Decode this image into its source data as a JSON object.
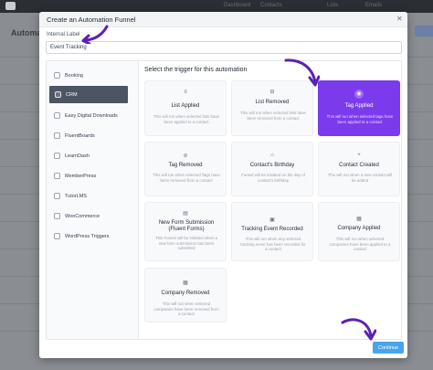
{
  "background": {
    "title": "Automat",
    "nav": [
      "Dashboard",
      "Contacts",
      "Lists",
      "Emails"
    ]
  },
  "modal": {
    "title": "Create an Automation Funnel",
    "internal_label": "Internal Label",
    "internal_value": "Event Tracking",
    "section_title": "Select the trigger for this automation",
    "continue_label": "Continue"
  },
  "sidebar": {
    "items": [
      {
        "label": "Booking"
      },
      {
        "label": "CRM"
      },
      {
        "label": "Easy Digital Downloads"
      },
      {
        "label": "FluentBoards"
      },
      {
        "label": "LearnDash"
      },
      {
        "label": "MemberPress"
      },
      {
        "label": "TutorLMS"
      },
      {
        "label": "WooCommerce"
      },
      {
        "label": "WordPress Triggers"
      }
    ]
  },
  "triggers": [
    {
      "title": "List Applied",
      "desc": "This will run when selected lists have been applied to a contact"
    },
    {
      "title": "List Removed",
      "desc": "This will run when selected lists have been removed from a contact"
    },
    {
      "title": "Tag Applied",
      "desc": "This will run when selected tags have been applied to a contact"
    },
    {
      "title": "Tag Removed",
      "desc": "This will run when selected Tags have been removed from a contact"
    },
    {
      "title": "Contact's Birthday",
      "desc": "Funnel will be initiated on the day of contact's birthday"
    },
    {
      "title": "Contact Created",
      "desc": "This will run when a new contact will be added"
    },
    {
      "title": "New Form Submission (Fluent Forms)",
      "desc": "This Funnel will be initiated when a new form submission has been submitted"
    },
    {
      "title": "Tracking Event Recorded",
      "desc": "This will run when any selected tracking event has been recorded for a contact"
    },
    {
      "title": "Company Applied",
      "desc": "This will run when selected companies have been applied to a contact"
    },
    {
      "title": "Company Removed",
      "desc": "This will run when selected companies have been removed from a contact"
    }
  ],
  "colors": {
    "accent": "#7c3aed",
    "active_sidebar": "#4b5563",
    "continue": "#4aa3ec",
    "annotation_arrow": "#5b21b6"
  }
}
